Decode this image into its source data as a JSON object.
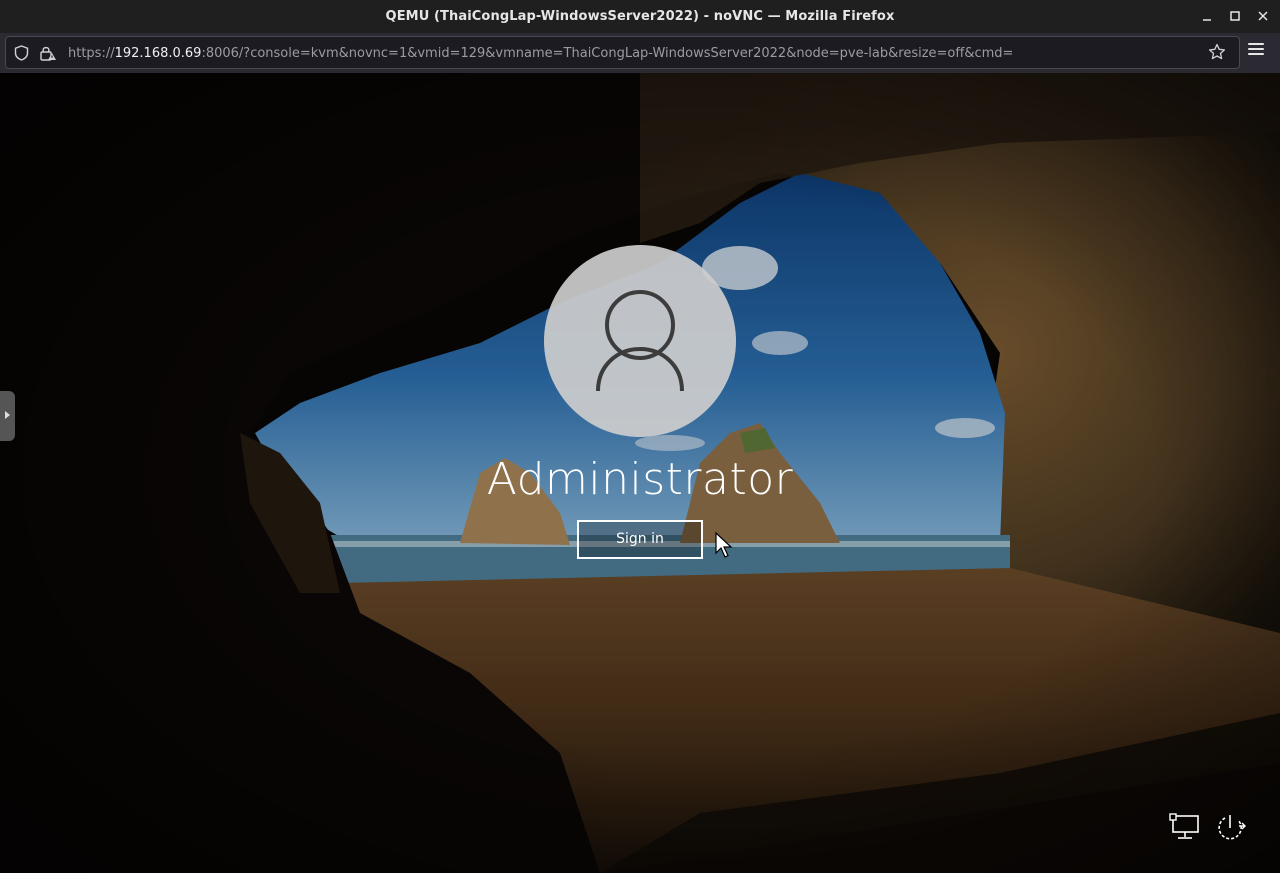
{
  "browser": {
    "window_title": "QEMU (ThaiCongLap-WindowsServer2022) - noVNC — Mozilla Firefox",
    "url_prefix": "https://",
    "url_host": "192.168.0.69",
    "url_rest": ":8006/?console=kvm&novnc=1&vmid=129&vmname=ThaiCongLap-WindowsServer2022&node=pve-lab&resize=off&cmd=",
    "window_controls": [
      "minimize-icon",
      "maximize-icon",
      "close-icon"
    ],
    "icons": [
      "shield-icon",
      "lock-icon",
      "bookmark-star-icon",
      "hamburger-menu-icon"
    ]
  },
  "novnc": {
    "control_bar_handle_icon": "expand-arrow-icon"
  },
  "login": {
    "username": "Administrator",
    "signin_label": "Sign in",
    "avatar_icon": "user-icon",
    "bottom_icons": [
      "network-icon",
      "power-icon"
    ]
  },
  "colors": {
    "title_bar": "#1f1f1f",
    "url_field": "#1c1b22",
    "avatar_bg": "#cdcdcd",
    "text": "#ffffff"
  }
}
